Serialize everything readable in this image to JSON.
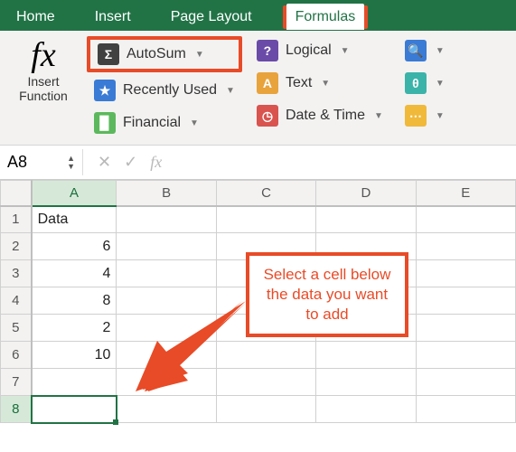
{
  "tabs": {
    "home": "Home",
    "insert": "Insert",
    "page_layout": "Page Layout",
    "formulas": "Formulas"
  },
  "ribbon": {
    "insert_function": "Insert\nFunction",
    "autosum": "AutoSum",
    "recent": "Recently Used",
    "financial": "Financial",
    "logical": "Logical",
    "text": "Text",
    "datetime": "Date & Time"
  },
  "namebox": "A8",
  "fx_label": "fx",
  "grid": {
    "cols": [
      "A",
      "B",
      "C",
      "D",
      "E"
    ],
    "rows": [
      {
        "n": "1",
        "A": "Data",
        "align": "l"
      },
      {
        "n": "2",
        "A": "6",
        "align": "r"
      },
      {
        "n": "3",
        "A": "4",
        "align": "r"
      },
      {
        "n": "4",
        "A": "8",
        "align": "r"
      },
      {
        "n": "5",
        "A": "2",
        "align": "r"
      },
      {
        "n": "6",
        "A": "10",
        "align": "r"
      },
      {
        "n": "7",
        "A": "",
        "align": "r"
      },
      {
        "n": "8",
        "A": "",
        "align": "r",
        "active": true
      }
    ]
  },
  "callout": "Select a cell below the data you want to add",
  "icons": {
    "sigma": "Σ",
    "star": "★",
    "book": "▉",
    "q": "?",
    "a": "A",
    "clock": "◷",
    "mag": "🔍",
    "theta": "θ",
    "dots": "⋯"
  },
  "chart_data": {
    "type": "table",
    "title": "Data",
    "categories": [
      "Row 2",
      "Row 3",
      "Row 4",
      "Row 5",
      "Row 6"
    ],
    "values": [
      6,
      4,
      8,
      2,
      10
    ],
    "xlabel": "",
    "ylabel": "",
    "ylim": [
      0,
      10
    ]
  }
}
